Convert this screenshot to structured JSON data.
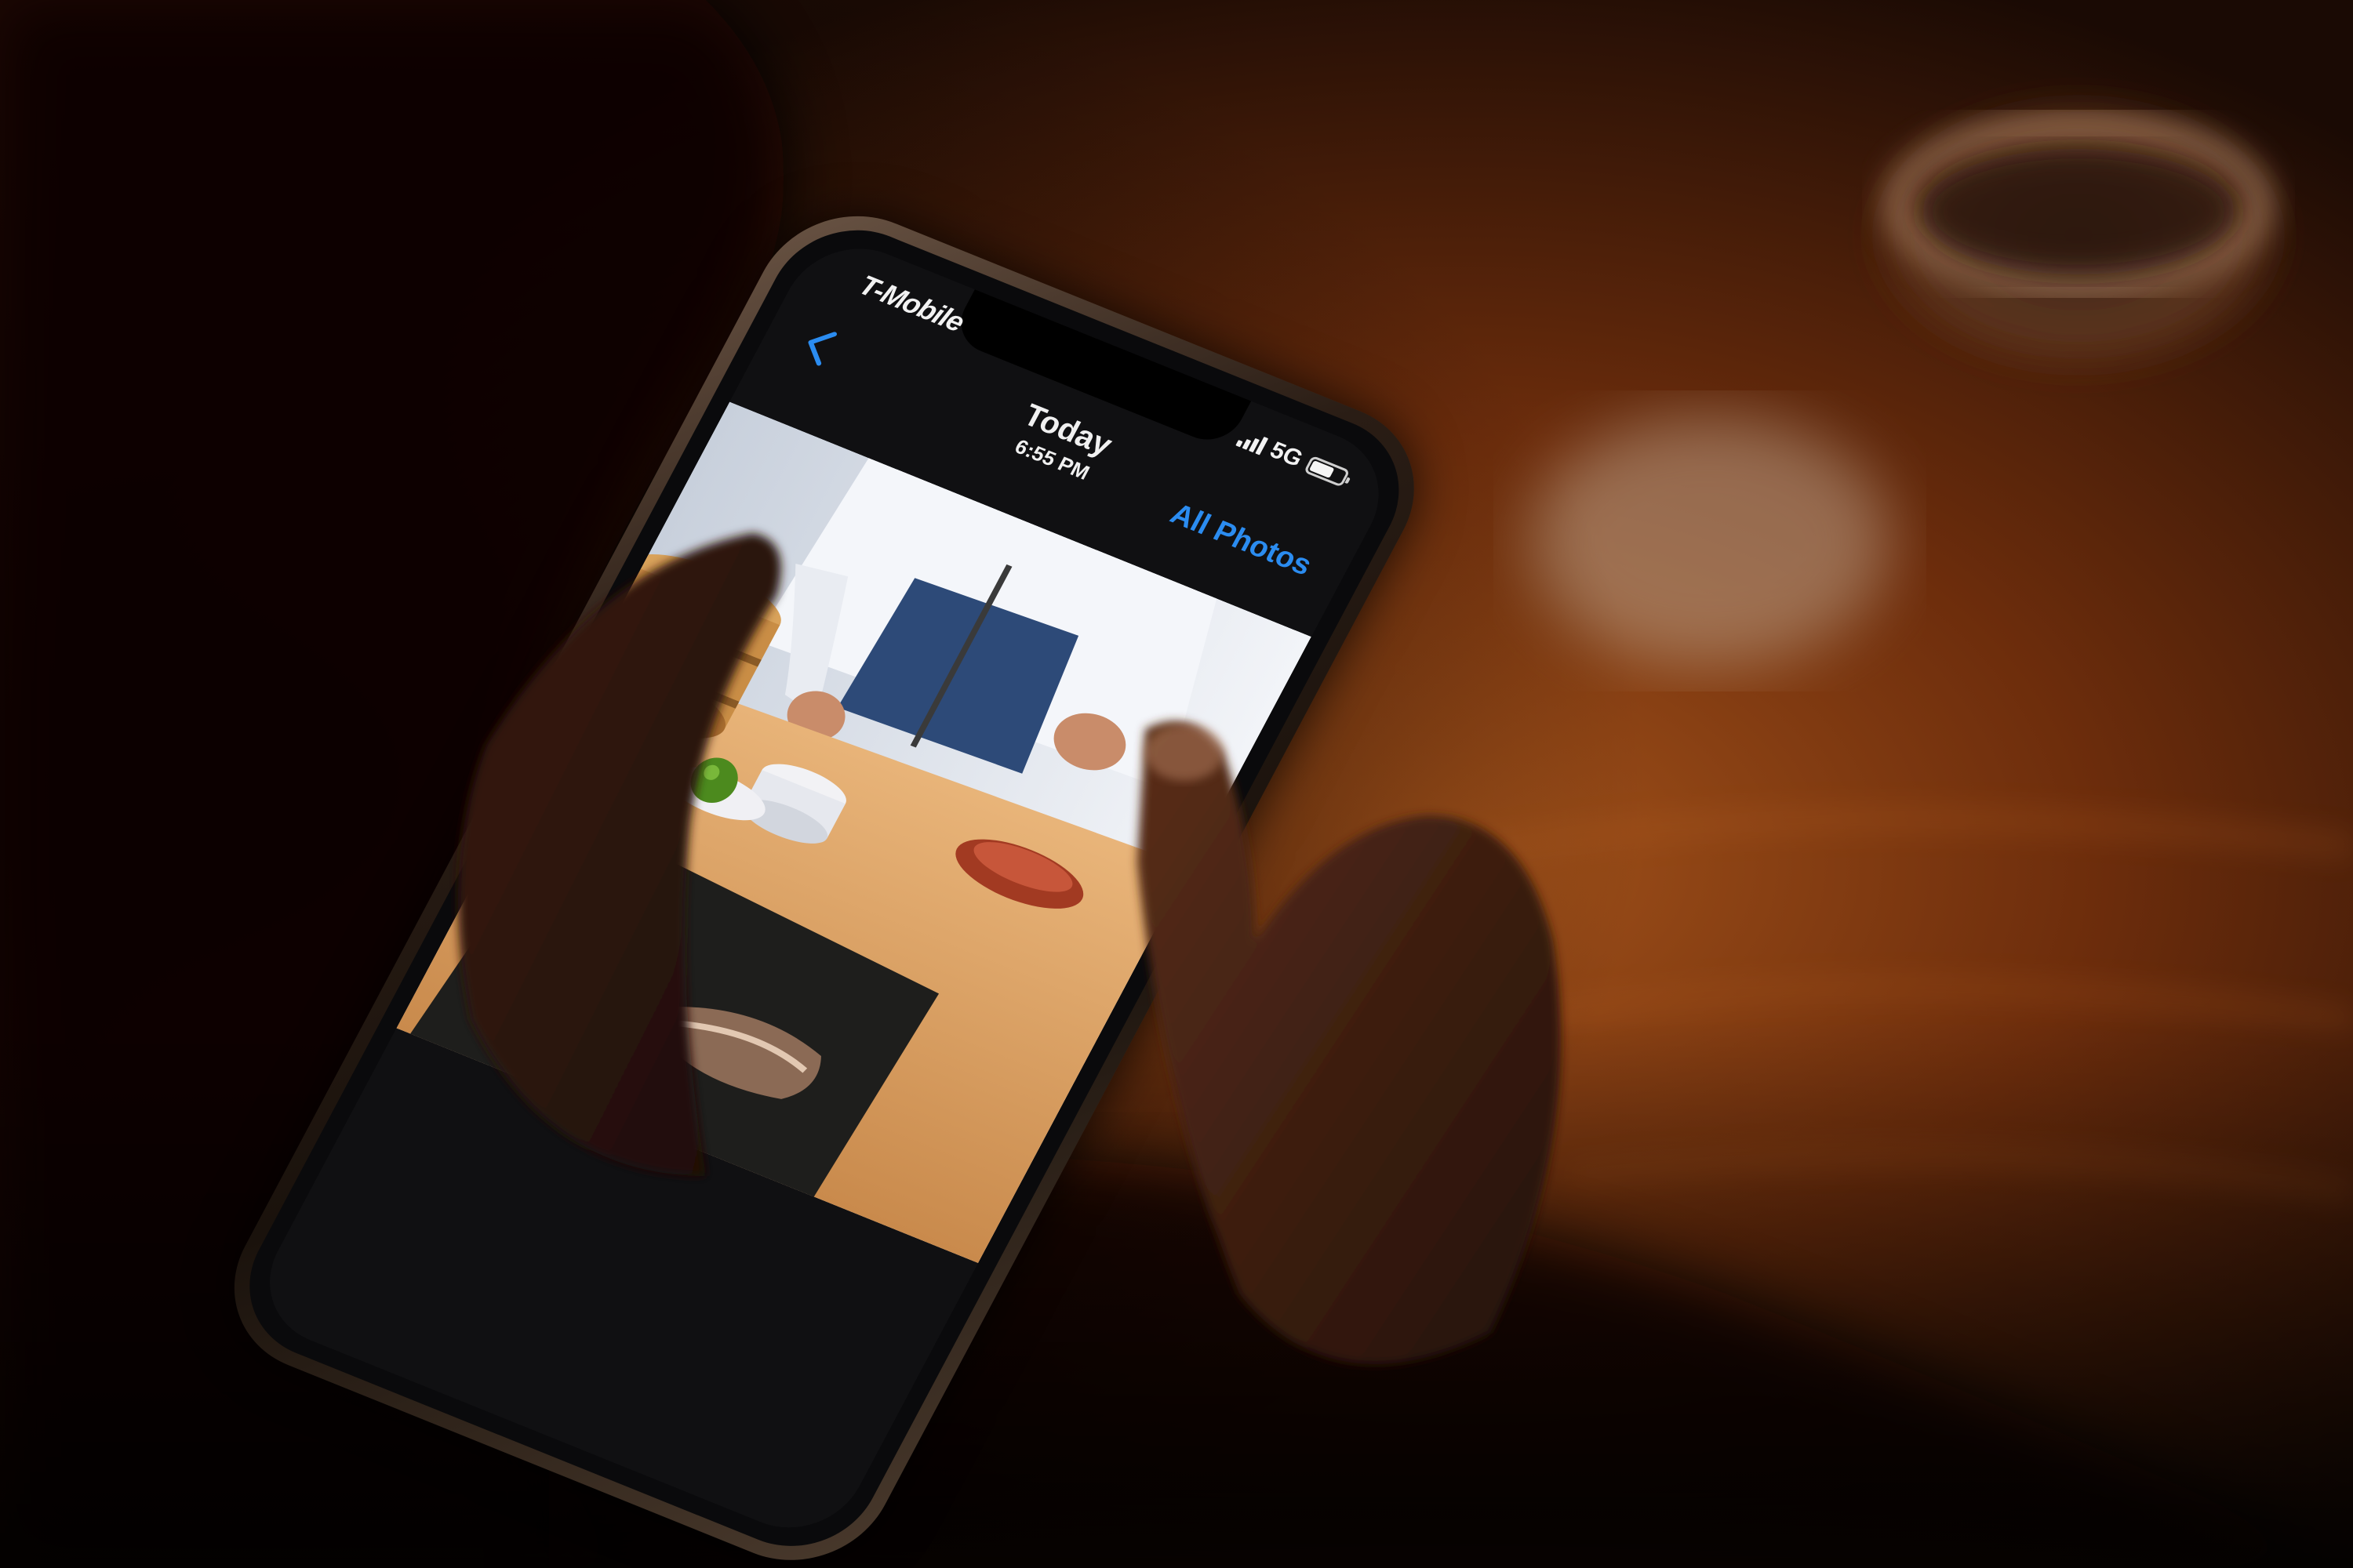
{
  "scene": {
    "description_colors": {
      "background": "#1a0c05",
      "table_warm": "#7a3a12",
      "accent_blue": "#2b8cf0"
    }
  },
  "status_bar": {
    "carrier": "T-Mobile",
    "network": "5G",
    "battery_level": 0.7
  },
  "nav_bar": {
    "back_icon": "chevron-left-icon",
    "title": "Today",
    "subtitle": "6:55 PM",
    "action_label": "All Photos"
  }
}
